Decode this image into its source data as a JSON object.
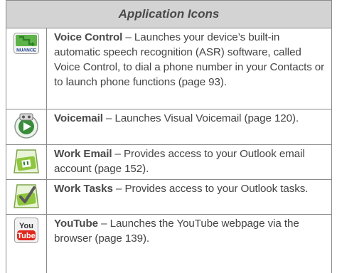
{
  "table": {
    "header": "Application Icons",
    "rows": [
      {
        "icon": "nuance-voice-control-icon",
        "icon_text": "NUANCE",
        "name": "Voice Control",
        "sep": " – ",
        "desc": "Launches your device’s built-in automatic speech recognition (ASR) software, called Voice Control, to dial a phone number in your Contacts or to launch phone functions (page 93)."
      },
      {
        "icon": "voicemail-icon",
        "name": "Voicemail",
        "sep": " – ",
        "desc": "Launches Visual Voicemail (page 120)."
      },
      {
        "icon": "work-email-icon",
        "name": "Work Email",
        "sep": " – ",
        "desc": "Provides access to your Outlook email account (page 152)."
      },
      {
        "icon": "work-tasks-icon",
        "name": "Work Tasks",
        "sep": " – ",
        "desc": "Provides access to your Outlook tasks."
      },
      {
        "icon": "youtube-icon",
        "icon_text_top": "You",
        "icon_text_bottom": "Tube",
        "name": "YouTube",
        "sep": " – ",
        "desc": "Launches the YouTube webpage via the browser (page 139)."
      }
    ]
  },
  "colors": {
    "header_bg": "#d3d3d3",
    "border": "#8a8a8a",
    "text": "#444444",
    "icon_green": "#8fc63f",
    "youtube_red": "#e0271e"
  }
}
